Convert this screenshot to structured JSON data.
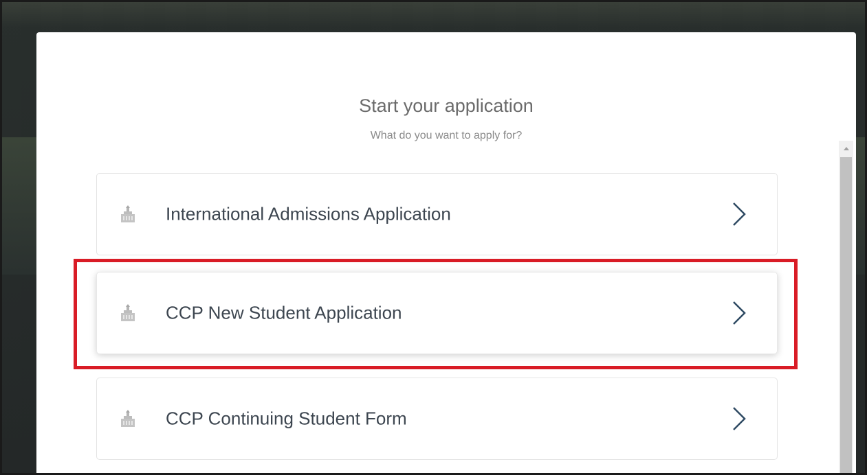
{
  "modal": {
    "title": "Start your application",
    "subtitle": "What do you want to apply for?"
  },
  "options": [
    {
      "label": "International Admissions Application",
      "icon": "building-icon"
    },
    {
      "label": "CCP New Student Application",
      "icon": "building-icon",
      "highlighted": true
    },
    {
      "label": "CCP Continuing Student Form",
      "icon": "building-icon"
    }
  ],
  "colors": {
    "highlight": "#d91c26",
    "chevron": "#2f4a63",
    "label": "#3d4650"
  }
}
